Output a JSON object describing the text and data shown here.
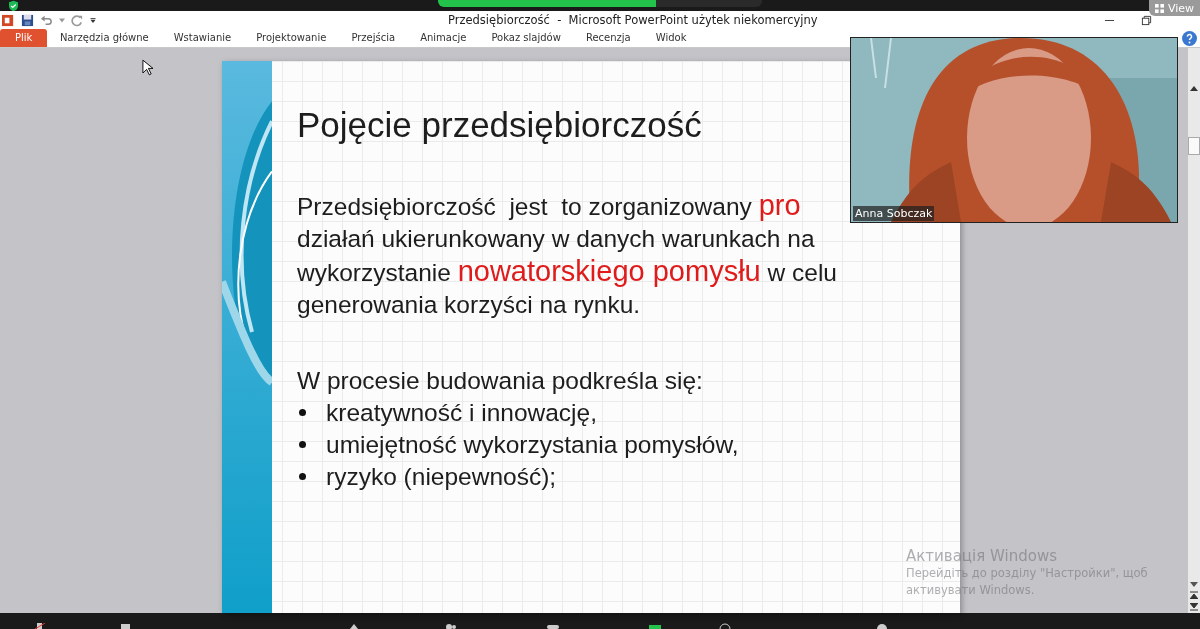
{
  "meeting_bar": {
    "view_button": "View"
  },
  "window": {
    "title": "Przedsiębiorczość  -  Microsoft PowerPoint użytek niekomercyjny"
  },
  "ribbon_tabs": [
    {
      "label": "Plik",
      "kind": "file"
    },
    {
      "label": "Narzędzia główne",
      "kind": "tab"
    },
    {
      "label": "Wstawianie",
      "kind": "tab"
    },
    {
      "label": "Projektowanie",
      "kind": "tab"
    },
    {
      "label": "Przejścia",
      "kind": "tab"
    },
    {
      "label": "Animacje",
      "kind": "tab"
    },
    {
      "label": "Pokaz slajdów",
      "kind": "tab"
    },
    {
      "label": "Recenzja",
      "kind": "tab"
    },
    {
      "label": "Widok",
      "kind": "tab"
    }
  ],
  "slide": {
    "title": "Pojęcie przedsiębiorczość",
    "paragraph": [
      [
        {
          "text": "Przedsiębiorczość  jest  to zorganizowany ",
          "accent": false
        },
        {
          "text": "pro",
          "accent": true
        }
      ],
      [
        {
          "text": "działań ukierunkowany w danych warunkach na",
          "accent": false
        }
      ],
      [
        {
          "text": "wykorzystanie ",
          "accent": false
        },
        {
          "text": "nowatorskiego pomysłu",
          "accent": true
        },
        {
          "text": " w celu",
          "accent": false
        }
      ],
      [
        {
          "text": "generowania korzyści na rynku.",
          "accent": false
        }
      ]
    ],
    "lead": "W procesie budowania podkreśla się:",
    "bullets": [
      "kreatywność i innowację,",
      "umiejętność wykorzystania pomysłów,",
      "ryzyko (niepewność);"
    ]
  },
  "video": {
    "name": "Anna Sobczak"
  },
  "activation": {
    "title": "Активація Windows",
    "lines": [
      "Перейдіть до розділу \"Настройки\", щоб",
      "активувати Windows."
    ]
  }
}
